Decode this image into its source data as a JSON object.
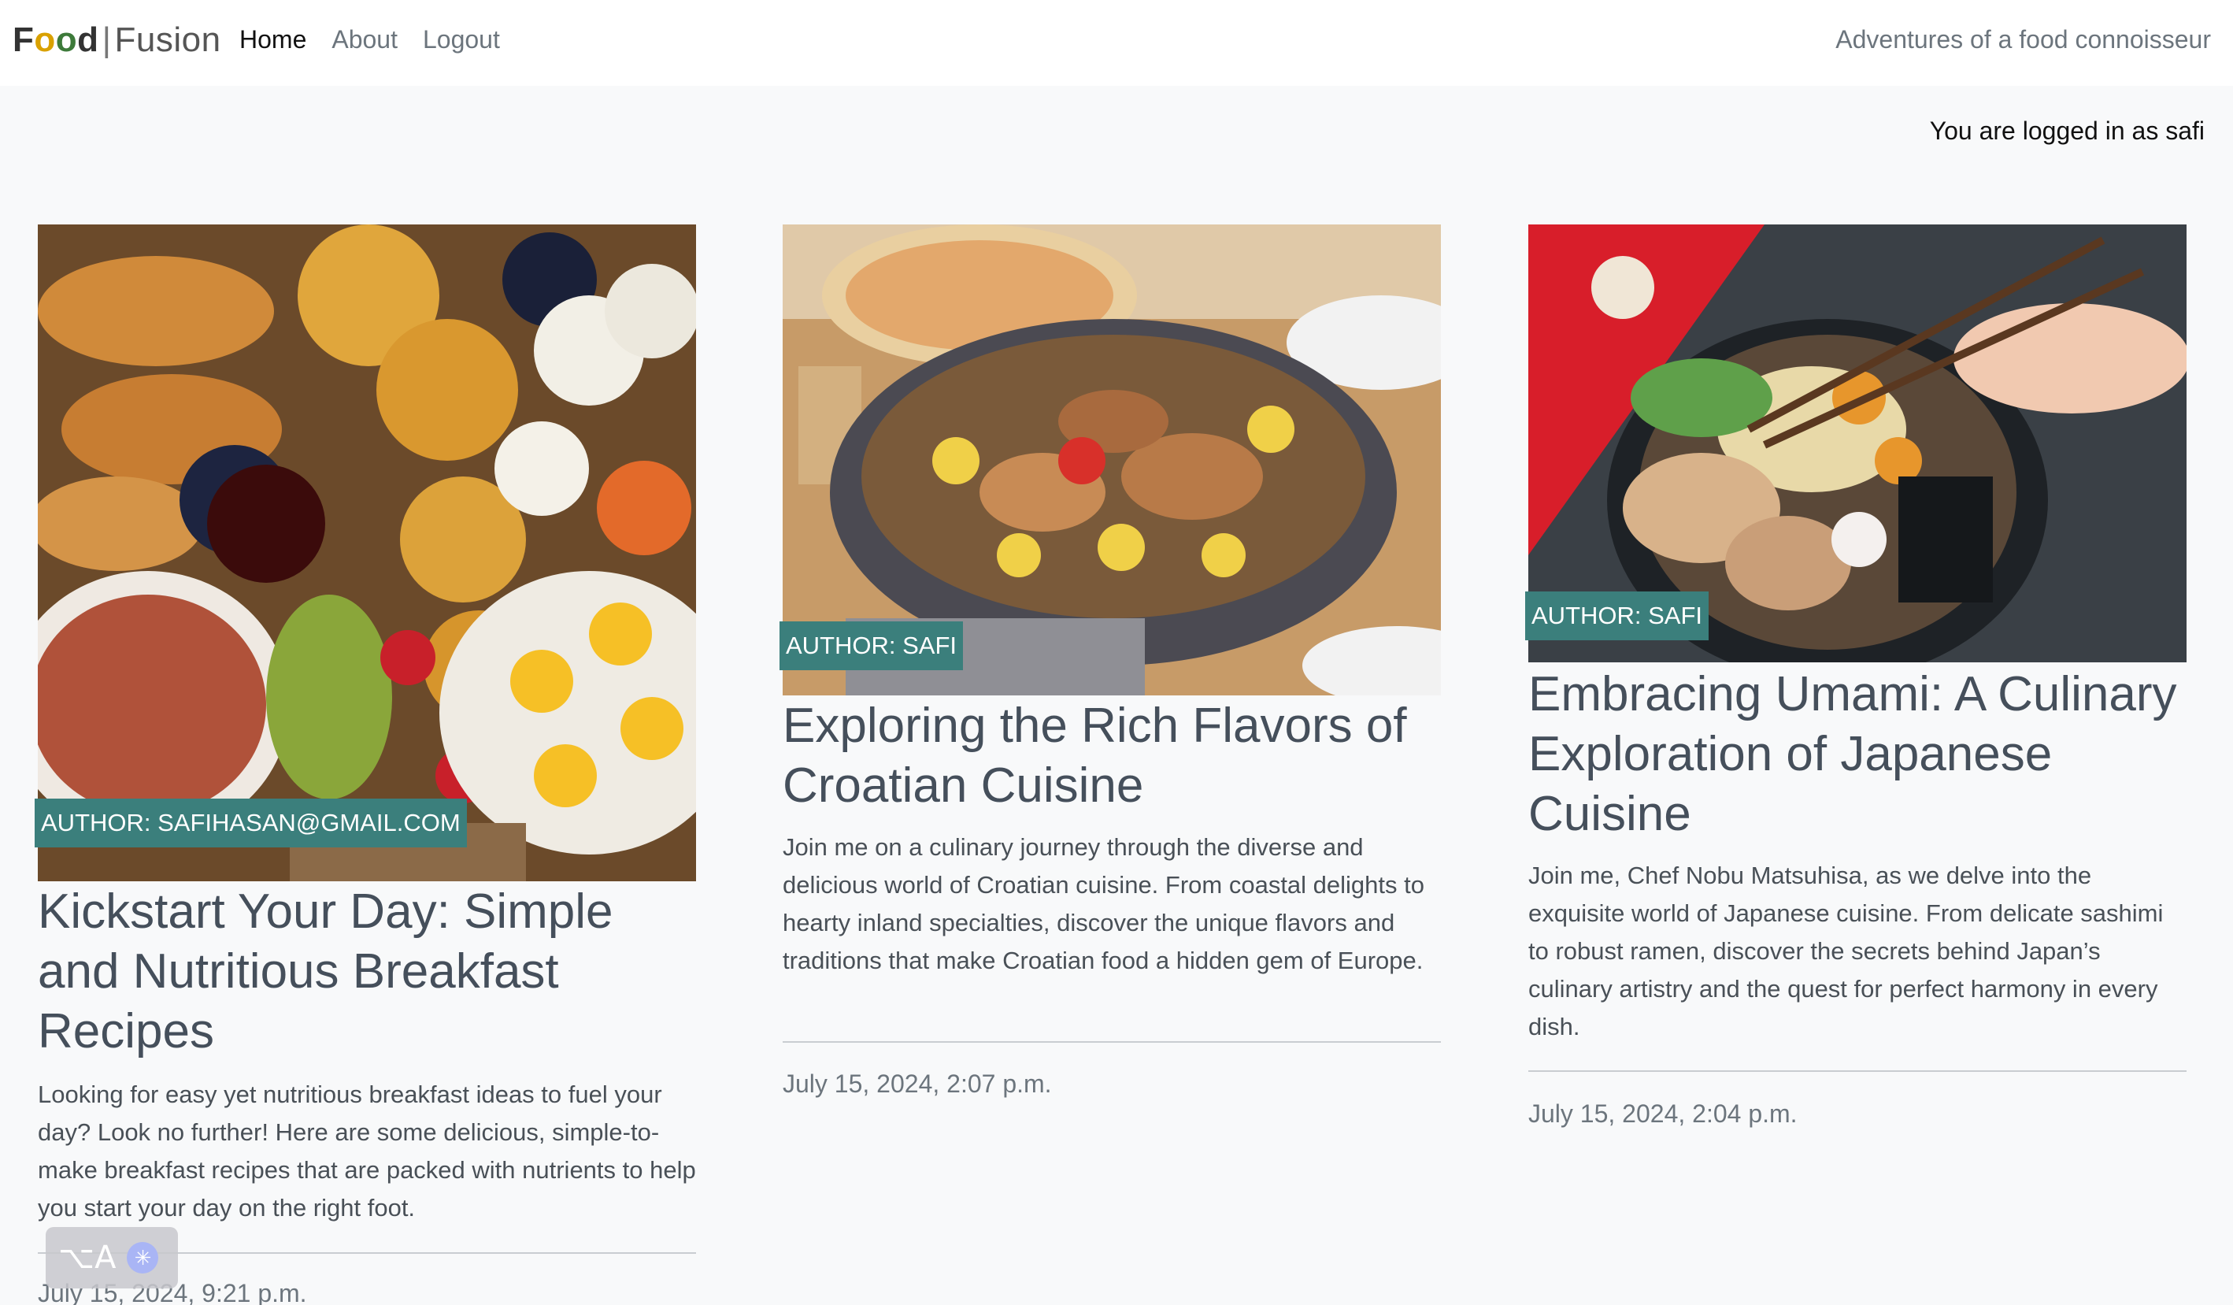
{
  "nav": {
    "brand_part1": "Food",
    "brand_sep": "|",
    "brand_part2": "Fusion",
    "links": [
      "Home",
      "About",
      "Logout"
    ],
    "tagline": "Adventures of a food connoisseur"
  },
  "session": {
    "logged_in_text": "You are logged in as safi"
  },
  "posts": [
    {
      "author": "AUTHOR: SAFIHASAN@GMAIL.COM",
      "title": "Kickstart Your Day: Simple and Nutritious Breakfast Recipes",
      "excerpt": "Looking for easy yet nutritious breakfast ideas to fuel your day? Look no further! Here are some delicious, simple-to-make breakfast recipes that are packed with nutrients to help you start your day on the right foot.",
      "date": "July 15, 2024, 9:21 p.m.",
      "image": "breakfast-platter-image"
    },
    {
      "author": "AUTHOR: SAFI",
      "title": "Exploring the Rich Flavors of Croatian Cuisine",
      "excerpt": "Join me on a culinary journey through the diverse and delicious world of Croatian cuisine. From coastal delights to hearty inland specialties, discover the unique flavors and traditions that make Croatian food a hidden gem of Europe.",
      "date": "July 15, 2024, 2:07 p.m.",
      "image": "croatian-peka-image"
    },
    {
      "author": "AUTHOR: SAFI",
      "title": "Embracing Umami: A Culinary Exploration of Japanese Cuisine",
      "excerpt": "Join me, Chef Nobu Matsuhisa, as we delve into the exquisite world of Japanese cuisine. From delicate sashimi to robust ramen, discover the secrets behind Japan’s culinary artistry and the quest for perfect harmony in every dish.",
      "date": "July 15, 2024, 2:04 p.m.",
      "image": "ramen-bowl-image"
    }
  ],
  "translate_widget": {
    "glyph": "⌥A",
    "icon": "translate-icon"
  },
  "colors": {
    "badge": "#3b7f7c",
    "title": "#454f5b",
    "background": "#f8f9fa"
  }
}
